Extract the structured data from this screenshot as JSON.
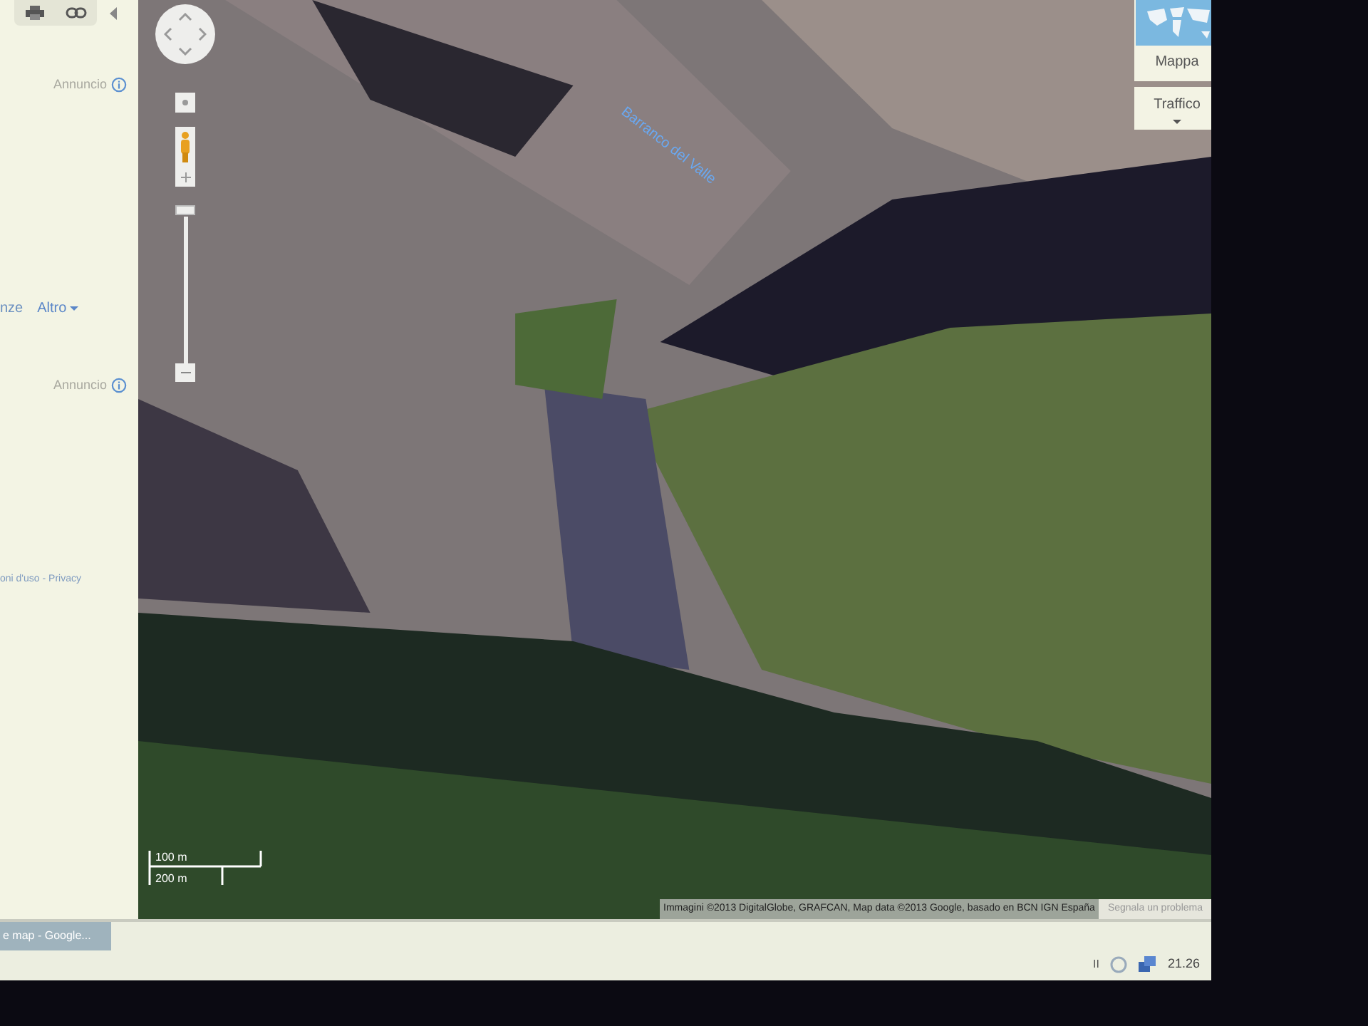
{
  "sidebar": {
    "ad_labels": [
      "Annuncio",
      "Annuncio"
    ],
    "links_partial": "nze",
    "more_link": "Altro",
    "footer_links": "oni d'uso - Privacy"
  },
  "map": {
    "place_label": "Barranco del Valle",
    "map_type": {
      "label": "Mappa"
    },
    "traffic": {
      "label": "Traffico"
    },
    "scale": [
      "100 m",
      "200 m"
    ],
    "attribution": "Immagini ©2013 DigitalGlobe, GRAFCAN, Map data ©2013 Google, basado en BCN IGN España",
    "report_link": "Segnala un problema"
  },
  "taskbar": {
    "window_button": "e map - Google...",
    "language": "II",
    "clock": "21.26"
  }
}
